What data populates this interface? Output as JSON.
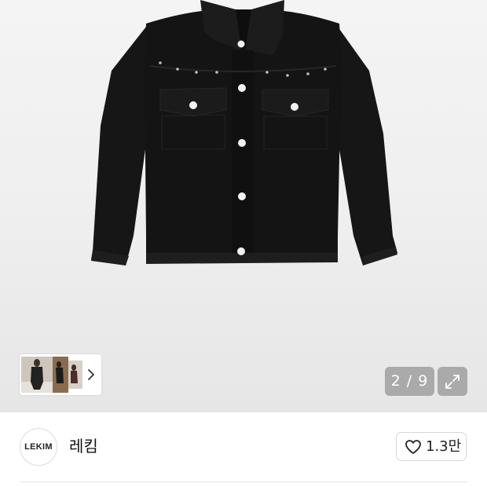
{
  "gallery": {
    "current_page": "2",
    "total_pages": "9",
    "counter_text": "2 / 9",
    "thumbnail_count": 3
  },
  "brand": {
    "logo_text": "LEKIM",
    "name": "레킴"
  },
  "like": {
    "count_text": "1.3만"
  },
  "colors": {
    "jacket": "#141414",
    "snap_buttons": "#f2f2f2",
    "counter_bg": "#969696",
    "background": "#efefef"
  },
  "icons": {
    "thumb_next": "chevron-right-icon",
    "expand": "expand-arrows-icon",
    "like": "heart-outline-icon"
  }
}
